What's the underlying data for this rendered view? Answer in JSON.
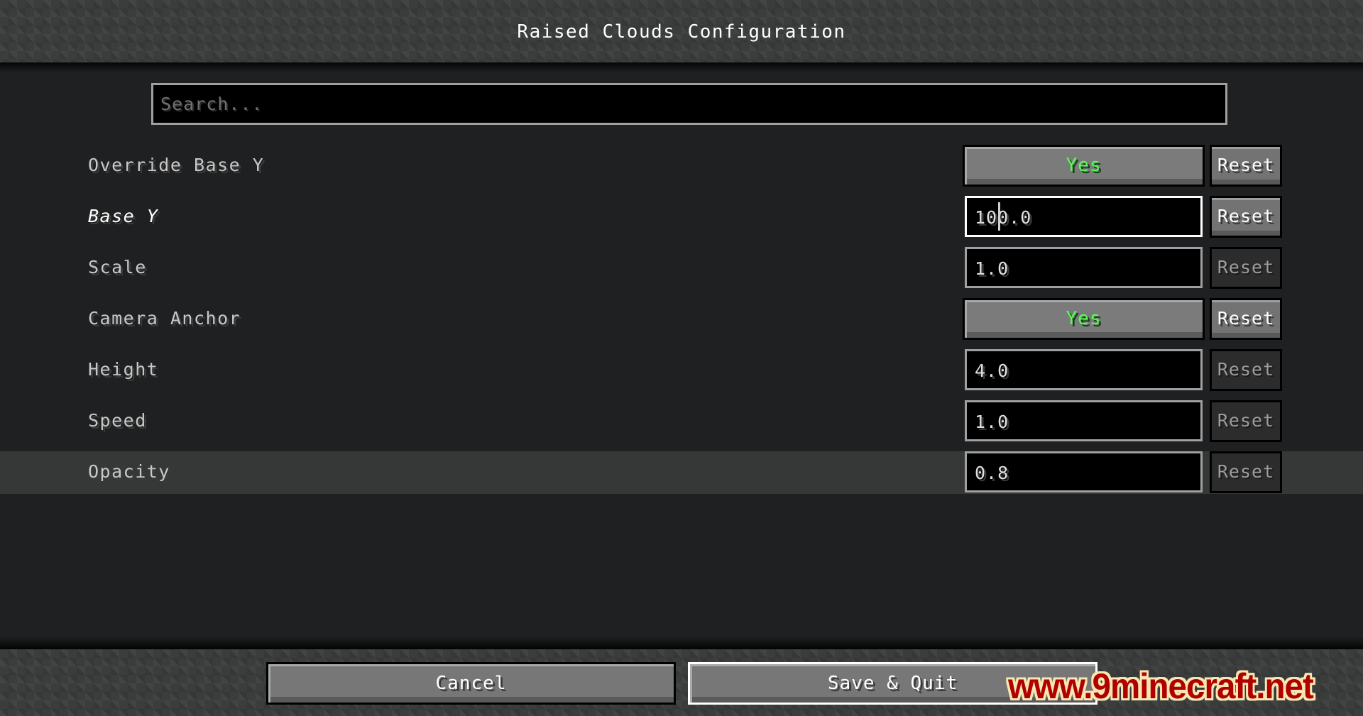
{
  "header": {
    "title": "Raised Clouds Configuration"
  },
  "search": {
    "placeholder": "Search...",
    "value": ""
  },
  "colors": {
    "toggle_on_text": "#55FF55",
    "background": "#1F2021",
    "highlight_row": "#363737",
    "focus_border": "#FFFFFF",
    "watermark": "#B00000"
  },
  "options": [
    {
      "label": "Override Base Y",
      "type": "toggle",
      "value": "Yes",
      "reset_label": "Reset",
      "reset_enabled": true,
      "label_italic": false,
      "focused": false,
      "hovered": false
    },
    {
      "label": "Base Y",
      "type": "text",
      "value": "100.0",
      "reset_label": "Reset",
      "reset_enabled": true,
      "label_italic": true,
      "focused": true,
      "hovered": false
    },
    {
      "label": "Scale",
      "type": "text",
      "value": "1.0",
      "reset_label": "Reset",
      "reset_enabled": false,
      "label_italic": false,
      "focused": false,
      "hovered": false
    },
    {
      "label": "Camera Anchor",
      "type": "toggle",
      "value": "Yes",
      "reset_label": "Reset",
      "reset_enabled": true,
      "label_italic": false,
      "focused": false,
      "hovered": false
    },
    {
      "label": "Height",
      "type": "text",
      "value": "4.0",
      "reset_label": "Reset",
      "reset_enabled": false,
      "label_italic": false,
      "focused": false,
      "hovered": false
    },
    {
      "label": "Speed",
      "type": "text",
      "value": "1.0",
      "reset_label": "Reset",
      "reset_enabled": false,
      "label_italic": false,
      "focused": false,
      "hovered": false
    },
    {
      "label": "Opacity",
      "type": "text",
      "value": "0.8",
      "reset_label": "Reset",
      "reset_enabled": false,
      "label_italic": false,
      "focused": false,
      "hovered": true
    }
  ],
  "footer": {
    "cancel_label": "Cancel",
    "save_label": "Save & Quit"
  },
  "watermark": {
    "text": "www.9minecraft.net"
  }
}
